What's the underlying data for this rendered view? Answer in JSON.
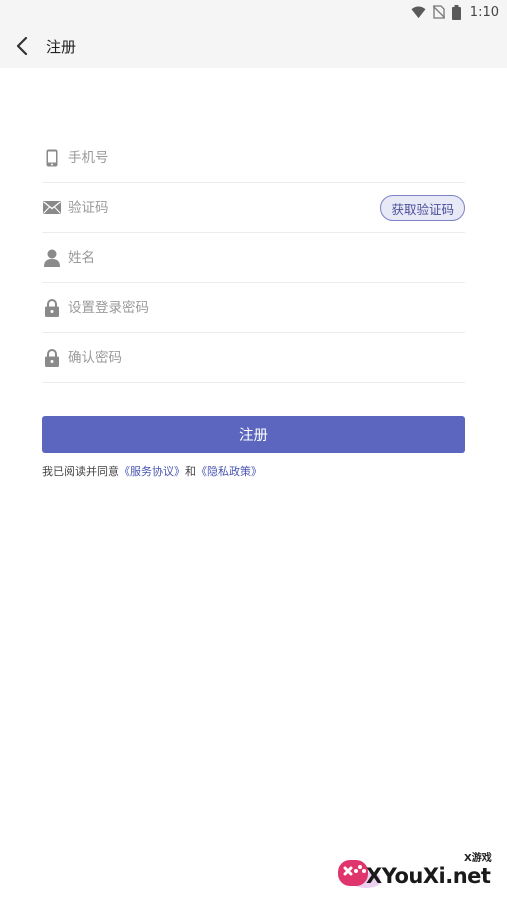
{
  "status_bar": {
    "time": "1:10"
  },
  "app_bar": {
    "title": "注册"
  },
  "form": {
    "phone_placeholder": "手机号",
    "code_placeholder": "验证码",
    "code_button": "获取验证码",
    "name_placeholder": "姓名",
    "password_placeholder": "设置登录密码",
    "confirm_placeholder": "确认密码"
  },
  "submit_label": "注册",
  "agreement": {
    "prefix": "我已阅读并同意",
    "service_link": "《服务协议》",
    "conjunction": "和",
    "privacy_link": "《隐私政策》"
  },
  "watermark": {
    "text": "XYouXi.net",
    "small": "X游戏"
  },
  "colors": {
    "primary": "#5c66be",
    "link": "#4a55b0",
    "app_bar_bg": "#f5f5f5"
  }
}
